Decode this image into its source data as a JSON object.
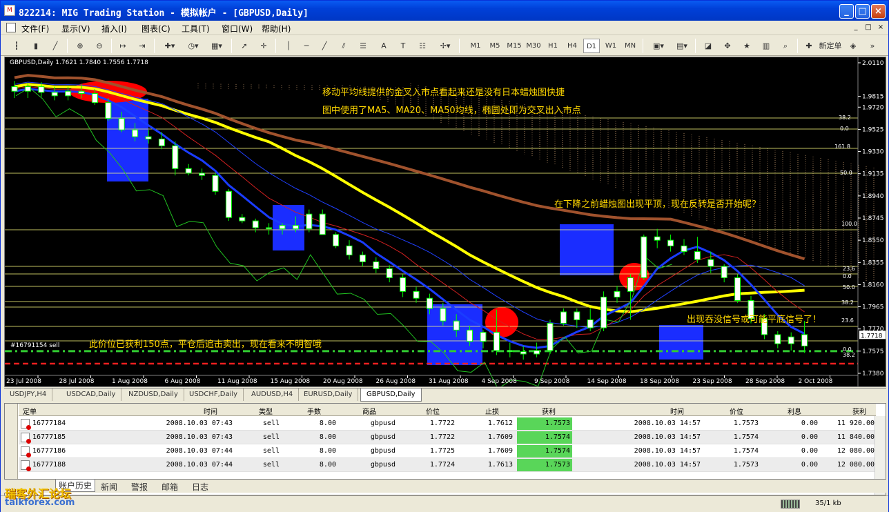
{
  "window": {
    "title": "822214: MIG Trading Station - 模拟帐户 - [GBPUSD,Daily]"
  },
  "menu": [
    "文件(F)",
    "显示(V)",
    "插入(I)",
    "图表(C)",
    "工具(T)",
    "窗口(W)",
    "帮助(H)"
  ],
  "toolbar": {
    "timeframes": [
      "M1",
      "M5",
      "M15",
      "M30",
      "H1",
      "H4",
      "D1",
      "W1",
      "MN"
    ],
    "selected_timeframe": "D1",
    "text_tools": [
      "A",
      "T"
    ],
    "new_order": "新定单"
  },
  "chart": {
    "info": "GBPUSD,Daily  1.7621 1.7840 1.7556 1.7718",
    "order_label": "#16791154 sell",
    "current_price": "1.7718",
    "annotations": [
      "移动平均线提供的金叉入市点看起来还是没有日本蜡烛图快捷",
      "图中使用了MA5、MA20、MA50均线，椭圆处即为交叉出入市点",
      "在下降之前蜡烛图出现平顶，现在反转是否开始呢？",
      "出现吞没信号或可能平底信号了！",
      "此价位已获利150点，平仓后追击卖出，现在看来不明智哦"
    ],
    "fib_labels_left": [
      "38.2",
      "0.0",
      "161.8",
      "50.0"
    ],
    "fib_labels_right": [
      "100.0",
      "23.6",
      "0.0",
      "50.0",
      "38.2",
      "23.6",
      "0.0",
      "38.2"
    ]
  },
  "chart_data": {
    "type": "candlestick",
    "symbol": "GBPUSD",
    "timeframe": "Daily",
    "ohlc_last": {
      "open": 1.7621,
      "high": 1.784,
      "low": 1.7556,
      "close": 1.7718
    },
    "y_ticks": [
      "2.0110",
      "1.9815",
      "1.9720",
      "1.9525",
      "1.9330",
      "1.9135",
      "1.8940",
      "1.8745",
      "1.8550",
      "1.8355",
      "1.8160",
      "1.7965",
      "1.7770",
      "1.7575",
      "1.7380"
    ],
    "x_ticks": [
      "23 Jul 2008",
      "28 Jul 2008",
      "1 Aug 2008",
      "6 Aug 2008",
      "11 Aug 2008",
      "15 Aug 2008",
      "20 Aug 2008",
      "26 Aug 2008",
      "31 Aug 2008",
      "4 Sep 2008",
      "9 Sep 2008",
      "14 Sep 2008",
      "18 Sep 2008",
      "23 Sep 2008",
      "28 Sep 2008",
      "2 Oct 2008"
    ],
    "candles": [
      [
        1.99,
        1.995,
        1.98,
        1.986
      ],
      [
        1.986,
        1.993,
        1.98,
        1.99
      ],
      [
        1.99,
        1.994,
        1.981,
        1.985
      ],
      [
        1.985,
        1.99,
        1.978,
        1.982
      ],
      [
        1.982,
        1.99,
        1.978,
        1.986
      ],
      [
        1.986,
        1.992,
        1.98,
        1.984
      ],
      [
        1.984,
        1.988,
        1.974,
        1.976
      ],
      [
        1.976,
        1.98,
        1.96,
        1.962
      ],
      [
        1.962,
        1.968,
        1.95,
        1.952
      ],
      [
        1.952,
        1.958,
        1.942,
        1.946
      ],
      [
        1.946,
        1.952,
        1.94,
        1.944
      ],
      [
        1.944,
        1.95,
        1.935,
        1.938
      ],
      [
        1.938,
        1.942,
        1.912,
        1.918
      ],
      [
        1.918,
        1.922,
        1.912,
        1.914
      ],
      [
        1.914,
        1.918,
        1.908,
        1.912
      ],
      [
        1.912,
        1.914,
        1.895,
        1.898
      ],
      [
        1.898,
        1.9,
        1.872,
        1.875
      ],
      [
        1.875,
        1.878,
        1.87,
        1.872
      ],
      [
        1.872,
        1.874,
        1.862,
        1.866
      ],
      [
        1.866,
        1.87,
        1.86,
        1.865
      ],
      [
        1.865,
        1.87,
        1.86,
        1.868
      ],
      [
        1.868,
        1.876,
        1.862,
        1.865
      ],
      [
        1.865,
        1.882,
        1.862,
        1.878
      ],
      [
        1.878,
        1.882,
        1.86,
        1.86
      ],
      [
        1.86,
        1.862,
        1.848,
        1.85
      ],
      [
        1.85,
        1.855,
        1.838,
        1.842
      ],
      [
        1.842,
        1.845,
        1.832,
        1.836
      ],
      [
        1.836,
        1.84,
        1.826,
        1.83
      ],
      [
        1.83,
        1.833,
        1.818,
        1.822
      ],
      [
        1.822,
        1.825,
        1.805,
        1.81
      ],
      [
        1.81,
        1.814,
        1.8,
        1.804
      ],
      [
        1.804,
        1.808,
        1.79,
        1.795
      ],
      [
        1.795,
        1.8,
        1.78,
        1.784
      ],
      [
        1.784,
        1.79,
        1.77,
        1.776
      ],
      [
        1.776,
        1.78,
        1.762,
        1.766
      ],
      [
        1.766,
        1.776,
        1.76,
        1.774
      ],
      [
        1.774,
        1.794,
        1.754,
        1.758
      ],
      [
        1.758,
        1.765,
        1.752,
        1.757
      ],
      [
        1.757,
        1.762,
        1.75,
        1.755
      ],
      [
        1.755,
        1.765,
        1.752,
        1.758
      ],
      [
        1.758,
        1.785,
        1.755,
        1.782
      ],
      [
        1.782,
        1.795,
        1.78,
        1.792
      ],
      [
        1.792,
        1.795,
        1.778,
        1.785
      ],
      [
        1.785,
        1.795,
        1.775,
        1.778
      ],
      [
        1.778,
        1.81,
        1.775,
        1.805
      ],
      [
        1.805,
        1.815,
        1.8,
        1.81
      ],
      [
        1.81,
        1.825,
        1.785,
        1.822
      ],
      [
        1.822,
        1.86,
        1.82,
        1.858
      ],
      [
        1.858,
        1.865,
        1.848,
        1.855
      ],
      [
        1.855,
        1.86,
        1.845,
        1.85
      ],
      [
        1.85,
        1.856,
        1.842,
        1.845
      ],
      [
        1.845,
        1.858,
        1.835,
        1.838
      ],
      [
        1.838,
        1.845,
        1.826,
        1.832
      ],
      [
        1.832,
        1.834,
        1.818,
        1.822
      ],
      [
        1.822,
        1.825,
        1.8,
        1.802
      ],
      [
        1.802,
        1.806,
        1.782,
        1.786
      ],
      [
        1.786,
        1.79,
        1.768,
        1.772
      ],
      [
        1.772,
        1.775,
        1.76,
        1.764
      ],
      [
        1.764,
        1.774,
        1.758,
        1.77
      ],
      [
        1.762,
        1.784,
        1.756,
        1.772
      ]
    ],
    "horizontal_levels": [
      1.7575,
      1.7465
    ],
    "moving_averages": [
      "MA5",
      "MA20",
      "MA50"
    ]
  },
  "chart_tabs": [
    "USDJPY,H4",
    "USDCAD,Daily",
    "NZDUSD,Daily",
    "USDCHF,Daily",
    "AUDUSD,H4",
    "EURUSD,Daily",
    "GBPUSD,Daily"
  ],
  "active_chart_tab": "GBPUSD,Daily",
  "terminal": {
    "headers": [
      "定单",
      "时间",
      "类型",
      "手数",
      "商品",
      "价位",
      "止损",
      "获利",
      "时间",
      "价位",
      "利息",
      "获利"
    ],
    "rows": [
      [
        "16777184",
        "2008.10.03 07:43",
        "sell",
        "8.00",
        "gbpusd",
        "1.7722",
        "1.7612",
        "1.7573",
        "2008.10.03 14:57",
        "1.7573",
        "0.00",
        "11 920.00"
      ],
      [
        "16777185",
        "2008.10.03 07:43",
        "sell",
        "8.00",
        "gbpusd",
        "1.7722",
        "1.7609",
        "1.7574",
        "2008.10.03 14:57",
        "1.7574",
        "0.00",
        "11 840.00"
      ],
      [
        "16777186",
        "2008.10.03 07:44",
        "sell",
        "8.00",
        "gbpusd",
        "1.7725",
        "1.7609",
        "1.7574",
        "2008.10.03 14:57",
        "1.7574",
        "0.00",
        "12 080.00"
      ],
      [
        "16777188",
        "2008.10.03 07:44",
        "sell",
        "8.00",
        "gbpusd",
        "1.7724",
        "1.7613",
        "1.7573",
        "2008.10.03 14:57",
        "1.7573",
        "0.00",
        "12 080.00"
      ]
    ],
    "bottom_tabs": [
      "账户历史",
      "新闻",
      "警报",
      "邮箱",
      "日志"
    ]
  },
  "status": {
    "traffic": "35/1 kb"
  },
  "watermark": {
    "line1": "瑞客外汇论坛",
    "line2": "talkforex.com"
  },
  "colors": {
    "bullish": "#ffffff",
    "bearish": "#00ff00",
    "ma5": "#ff0000",
    "ma20": "#ffff00",
    "ma50": "#a0522d",
    "fib": "#ffff80",
    "box": "#1a2dff"
  }
}
